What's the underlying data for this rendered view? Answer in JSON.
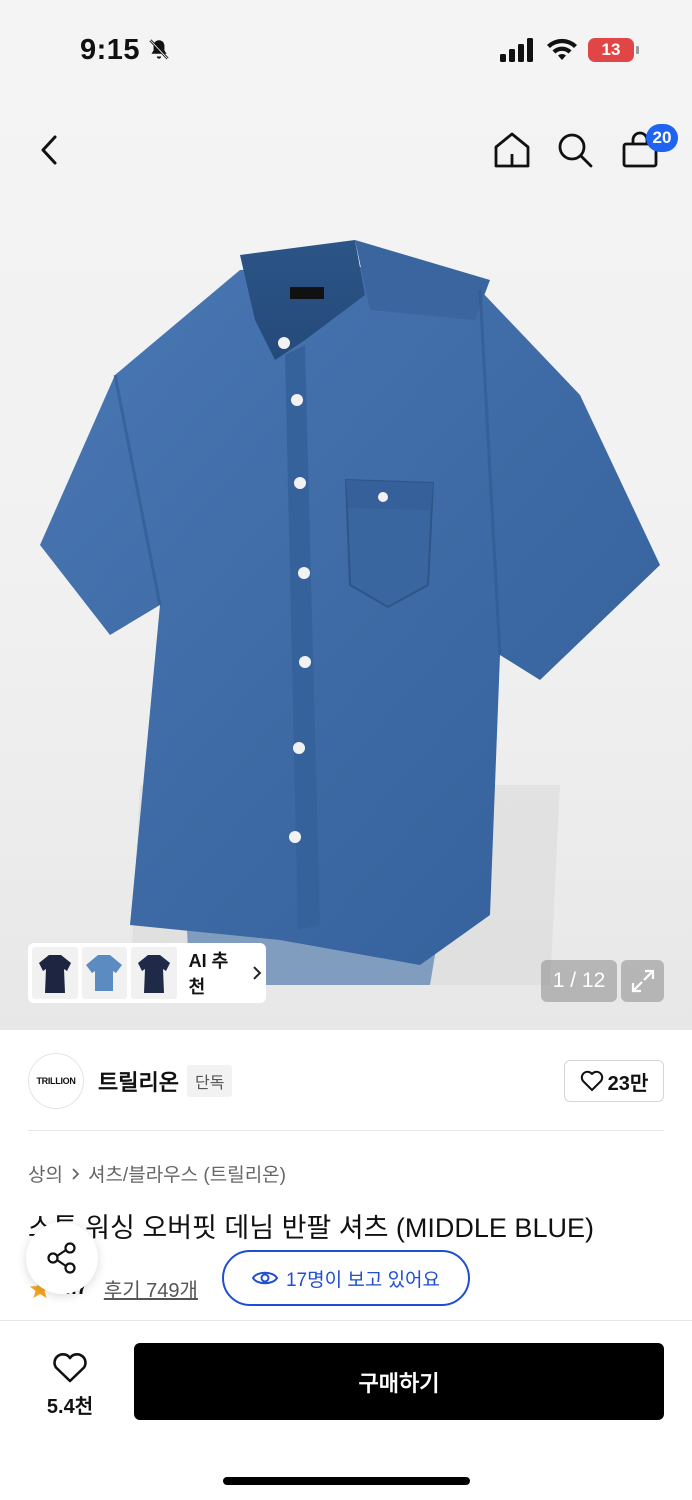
{
  "status_bar": {
    "time": "9:15",
    "battery": "13",
    "icons": [
      "bell-muted-icon",
      "signal-icon",
      "wifi-icon",
      "battery-icon"
    ]
  },
  "nav": {
    "cart_count": "20",
    "icons": [
      "back-icon",
      "home-icon",
      "search-icon",
      "cart-icon"
    ]
  },
  "gallery": {
    "ai_label": "AI 추천",
    "page_indicator": "1 / 12",
    "logo_text": "TRILLION"
  },
  "brand": {
    "name": "트릴리온",
    "tag": "단독",
    "logo_text": "TRILLION",
    "likes": "23만"
  },
  "breadcrumb": {
    "category": "상의",
    "subcategory": "셔츠/블라우스 (트릴리온)"
  },
  "product": {
    "title": "스톤 워싱 오버핏 데님 반팔 셔츠 (MIDDLE BLUE)",
    "rating": "4.7",
    "reviews": "후기 749개",
    "viewers": "17명이 보고 있어요"
  },
  "bottom_bar": {
    "wish_count": "5.4천",
    "buy_label": "구매하기"
  },
  "colors": {
    "accent_blue": "#1f4fd0",
    "badge_blue": "#1f63f0",
    "star": "#f5a623",
    "battery_red": "#e04646",
    "denim": "#3e6aa5"
  }
}
